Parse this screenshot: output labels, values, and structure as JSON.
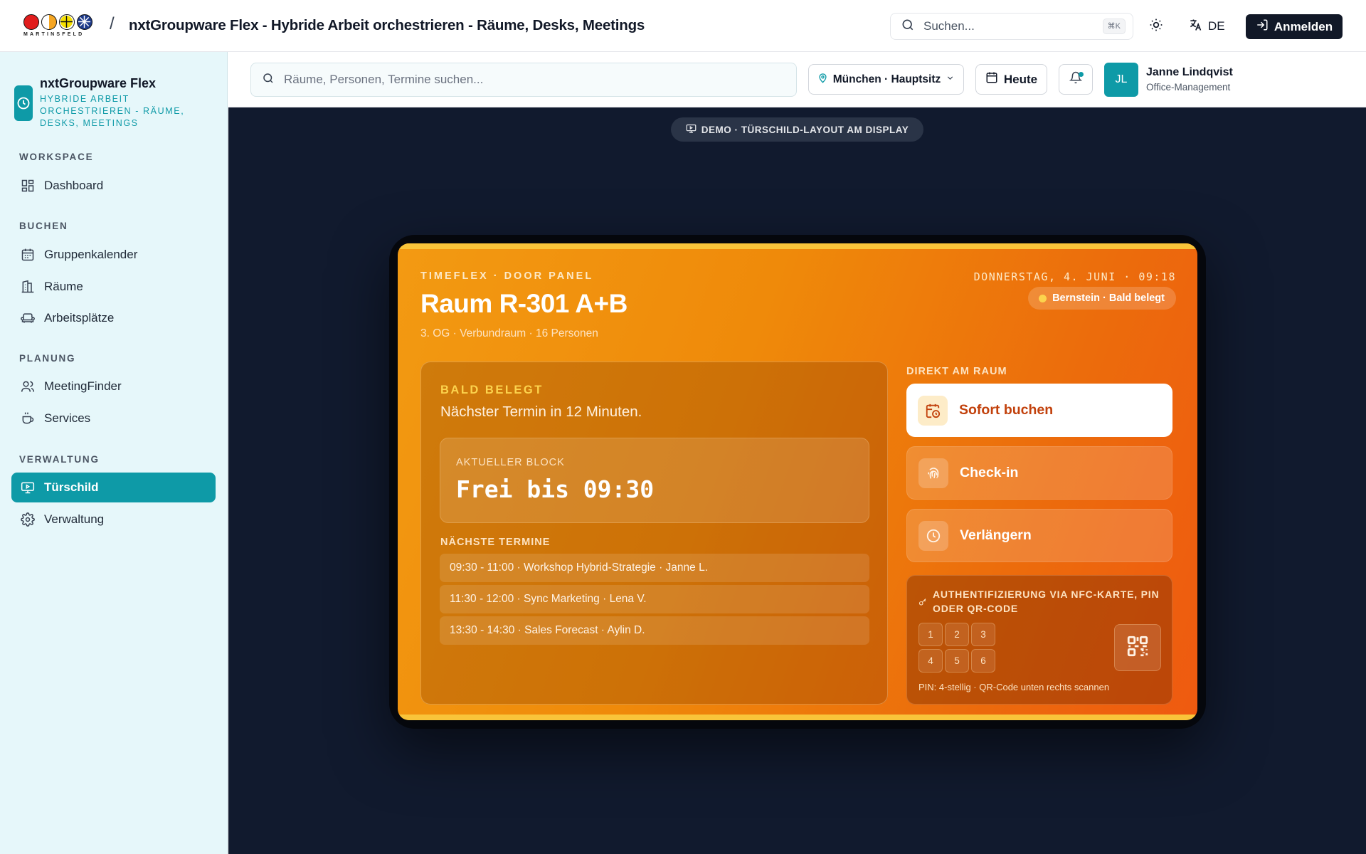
{
  "topbar": {
    "logo_word": "MARTINSFELD",
    "separator": "/",
    "title": "nxtGroupware Flex - Hybride Arbeit orchestrieren - Räume, Desks, Meetings",
    "search_placeholder": "Suchen...",
    "search_shortcut": "⌘K",
    "language": "DE",
    "login_label": "Anmelden"
  },
  "sidebar": {
    "brand_name": "nxtGroupware Flex",
    "brand_sub": "Hybride Arbeit orchestrieren - Räume, Desks, Meetings",
    "sections": [
      {
        "label": "Workspace",
        "items": [
          {
            "label": "Dashboard",
            "icon": "dashboard-icon"
          }
        ]
      },
      {
        "label": "Buchen",
        "items": [
          {
            "label": "Gruppenkalender",
            "icon": "calendar-icon"
          },
          {
            "label": "Räume",
            "icon": "building-icon"
          },
          {
            "label": "Arbeitsplätze",
            "icon": "sofa-icon"
          }
        ]
      },
      {
        "label": "Planung",
        "items": [
          {
            "label": "MeetingFinder",
            "icon": "users-icon"
          },
          {
            "label": "Services",
            "icon": "coffee-icon"
          }
        ]
      },
      {
        "label": "Verwaltung",
        "items": [
          {
            "label": "Türschild",
            "icon": "monitor-icon",
            "active": true
          },
          {
            "label": "Verwaltung",
            "icon": "gear-icon"
          }
        ]
      }
    ]
  },
  "header": {
    "search_placeholder": "Räume, Personen, Termine suchen...",
    "location": "München · Hauptsitz",
    "today_label": "Heute",
    "user_initials": "JL",
    "user_name": "Janne Lindqvist",
    "user_role": "Office-Management"
  },
  "stage": {
    "demo_label": "DEMO · TÜRSCHILD-LAYOUT AM DISPLAY"
  },
  "panel": {
    "eyebrow": "TIMEFLEX · DOOR PANEL",
    "room_name": "Raum R-301 A+B",
    "room_meta": "3. OG · Verbundraum · 16 Personen",
    "datetime": "DONNERSTAG, 4. JUNI · 09:18",
    "status": "Bernstein · Bald belegt",
    "state_label": "BALD BELEGT",
    "next_text": "Nächster Termin in 12 Minuten.",
    "block_label": "AKTUELLER BLOCK",
    "block_value": "Frei bis 09:30",
    "upcoming_label": "NÄCHSTE TERMINE",
    "upcoming": [
      "09:30 - 11:00 · Workshop Hybrid-Strategie · Janne L.",
      "11:30 - 12:00 · Sync Marketing · Lena V.",
      "13:30 - 14:30 · Sales Forecast · Aylin D."
    ],
    "direct_label": "DIREKT AM RAUM",
    "actions": [
      {
        "label": "Sofort buchen",
        "icon": "calendar-clock-icon"
      },
      {
        "label": "Check-in",
        "icon": "fingerprint-icon"
      },
      {
        "label": "Verlängern",
        "icon": "clock-icon"
      }
    ],
    "auth_title": "AUTHENTIFIZIERUNG VIA NFC-KARTE, PIN ODER QR-CODE",
    "keypad": [
      "1",
      "2",
      "3",
      "4",
      "5",
      "6"
    ],
    "auth_hint": "PIN: 4-stellig · QR-Code unten rechts scannen"
  },
  "colors": {
    "accent": "#0e9aa7",
    "panel_orange": "#ef8a0a",
    "stage_bg": "#111a2e",
    "status_dot": "#fcd34d"
  }
}
